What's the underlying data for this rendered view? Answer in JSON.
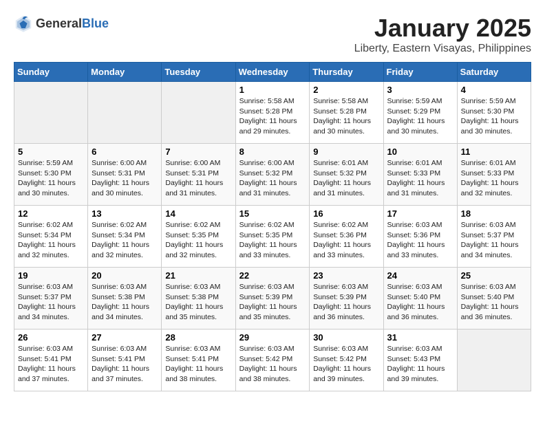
{
  "header": {
    "logo_general": "General",
    "logo_blue": "Blue",
    "month": "January 2025",
    "location": "Liberty, Eastern Visayas, Philippines"
  },
  "weekdays": [
    "Sunday",
    "Monday",
    "Tuesday",
    "Wednesday",
    "Thursday",
    "Friday",
    "Saturday"
  ],
  "weeks": [
    [
      {
        "day": "",
        "sunrise": "",
        "sunset": "",
        "daylight": ""
      },
      {
        "day": "",
        "sunrise": "",
        "sunset": "",
        "daylight": ""
      },
      {
        "day": "",
        "sunrise": "",
        "sunset": "",
        "daylight": ""
      },
      {
        "day": "1",
        "sunrise": "Sunrise: 5:58 AM",
        "sunset": "Sunset: 5:28 PM",
        "daylight": "Daylight: 11 hours and 29 minutes."
      },
      {
        "day": "2",
        "sunrise": "Sunrise: 5:58 AM",
        "sunset": "Sunset: 5:28 PM",
        "daylight": "Daylight: 11 hours and 30 minutes."
      },
      {
        "day": "3",
        "sunrise": "Sunrise: 5:59 AM",
        "sunset": "Sunset: 5:29 PM",
        "daylight": "Daylight: 11 hours and 30 minutes."
      },
      {
        "day": "4",
        "sunrise": "Sunrise: 5:59 AM",
        "sunset": "Sunset: 5:30 PM",
        "daylight": "Daylight: 11 hours and 30 minutes."
      }
    ],
    [
      {
        "day": "5",
        "sunrise": "Sunrise: 5:59 AM",
        "sunset": "Sunset: 5:30 PM",
        "daylight": "Daylight: 11 hours and 30 minutes."
      },
      {
        "day": "6",
        "sunrise": "Sunrise: 6:00 AM",
        "sunset": "Sunset: 5:31 PM",
        "daylight": "Daylight: 11 hours and 30 minutes."
      },
      {
        "day": "7",
        "sunrise": "Sunrise: 6:00 AM",
        "sunset": "Sunset: 5:31 PM",
        "daylight": "Daylight: 11 hours and 31 minutes."
      },
      {
        "day": "8",
        "sunrise": "Sunrise: 6:00 AM",
        "sunset": "Sunset: 5:32 PM",
        "daylight": "Daylight: 11 hours and 31 minutes."
      },
      {
        "day": "9",
        "sunrise": "Sunrise: 6:01 AM",
        "sunset": "Sunset: 5:32 PM",
        "daylight": "Daylight: 11 hours and 31 minutes."
      },
      {
        "day": "10",
        "sunrise": "Sunrise: 6:01 AM",
        "sunset": "Sunset: 5:33 PM",
        "daylight": "Daylight: 11 hours and 31 minutes."
      },
      {
        "day": "11",
        "sunrise": "Sunrise: 6:01 AM",
        "sunset": "Sunset: 5:33 PM",
        "daylight": "Daylight: 11 hours and 32 minutes."
      }
    ],
    [
      {
        "day": "12",
        "sunrise": "Sunrise: 6:02 AM",
        "sunset": "Sunset: 5:34 PM",
        "daylight": "Daylight: 11 hours and 32 minutes."
      },
      {
        "day": "13",
        "sunrise": "Sunrise: 6:02 AM",
        "sunset": "Sunset: 5:34 PM",
        "daylight": "Daylight: 11 hours and 32 minutes."
      },
      {
        "day": "14",
        "sunrise": "Sunrise: 6:02 AM",
        "sunset": "Sunset: 5:35 PM",
        "daylight": "Daylight: 11 hours and 32 minutes."
      },
      {
        "day": "15",
        "sunrise": "Sunrise: 6:02 AM",
        "sunset": "Sunset: 5:35 PM",
        "daylight": "Daylight: 11 hours and 33 minutes."
      },
      {
        "day": "16",
        "sunrise": "Sunrise: 6:02 AM",
        "sunset": "Sunset: 5:36 PM",
        "daylight": "Daylight: 11 hours and 33 minutes."
      },
      {
        "day": "17",
        "sunrise": "Sunrise: 6:03 AM",
        "sunset": "Sunset: 5:36 PM",
        "daylight": "Daylight: 11 hours and 33 minutes."
      },
      {
        "day": "18",
        "sunrise": "Sunrise: 6:03 AM",
        "sunset": "Sunset: 5:37 PM",
        "daylight": "Daylight: 11 hours and 34 minutes."
      }
    ],
    [
      {
        "day": "19",
        "sunrise": "Sunrise: 6:03 AM",
        "sunset": "Sunset: 5:37 PM",
        "daylight": "Daylight: 11 hours and 34 minutes."
      },
      {
        "day": "20",
        "sunrise": "Sunrise: 6:03 AM",
        "sunset": "Sunset: 5:38 PM",
        "daylight": "Daylight: 11 hours and 34 minutes."
      },
      {
        "day": "21",
        "sunrise": "Sunrise: 6:03 AM",
        "sunset": "Sunset: 5:38 PM",
        "daylight": "Daylight: 11 hours and 35 minutes."
      },
      {
        "day": "22",
        "sunrise": "Sunrise: 6:03 AM",
        "sunset": "Sunset: 5:39 PM",
        "daylight": "Daylight: 11 hours and 35 minutes."
      },
      {
        "day": "23",
        "sunrise": "Sunrise: 6:03 AM",
        "sunset": "Sunset: 5:39 PM",
        "daylight": "Daylight: 11 hours and 36 minutes."
      },
      {
        "day": "24",
        "sunrise": "Sunrise: 6:03 AM",
        "sunset": "Sunset: 5:40 PM",
        "daylight": "Daylight: 11 hours and 36 minutes."
      },
      {
        "day": "25",
        "sunrise": "Sunrise: 6:03 AM",
        "sunset": "Sunset: 5:40 PM",
        "daylight": "Daylight: 11 hours and 36 minutes."
      }
    ],
    [
      {
        "day": "26",
        "sunrise": "Sunrise: 6:03 AM",
        "sunset": "Sunset: 5:41 PM",
        "daylight": "Daylight: 11 hours and 37 minutes."
      },
      {
        "day": "27",
        "sunrise": "Sunrise: 6:03 AM",
        "sunset": "Sunset: 5:41 PM",
        "daylight": "Daylight: 11 hours and 37 minutes."
      },
      {
        "day": "28",
        "sunrise": "Sunrise: 6:03 AM",
        "sunset": "Sunset: 5:41 PM",
        "daylight": "Daylight: 11 hours and 38 minutes."
      },
      {
        "day": "29",
        "sunrise": "Sunrise: 6:03 AM",
        "sunset": "Sunset: 5:42 PM",
        "daylight": "Daylight: 11 hours and 38 minutes."
      },
      {
        "day": "30",
        "sunrise": "Sunrise: 6:03 AM",
        "sunset": "Sunset: 5:42 PM",
        "daylight": "Daylight: 11 hours and 39 minutes."
      },
      {
        "day": "31",
        "sunrise": "Sunrise: 6:03 AM",
        "sunset": "Sunset: 5:43 PM",
        "daylight": "Daylight: 11 hours and 39 minutes."
      },
      {
        "day": "",
        "sunrise": "",
        "sunset": "",
        "daylight": ""
      }
    ]
  ]
}
